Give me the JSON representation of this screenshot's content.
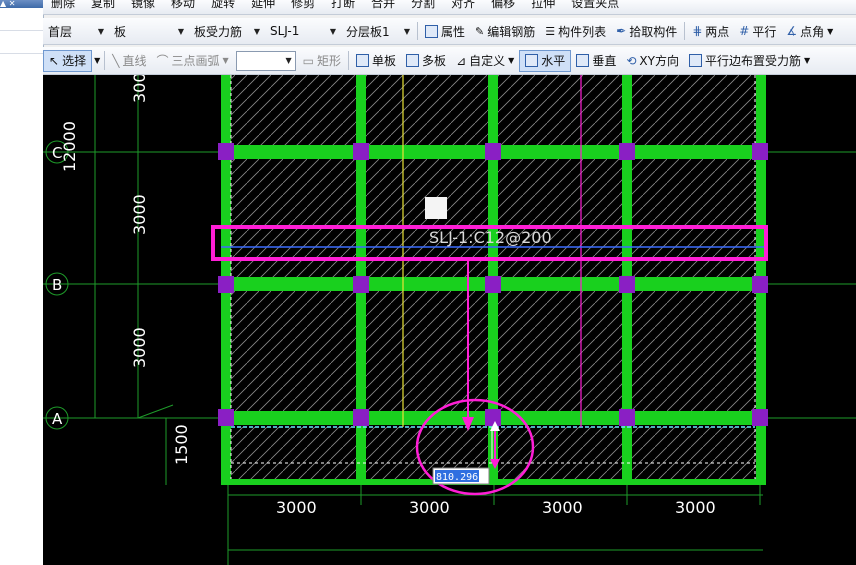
{
  "toolbar_top": {
    "items": [
      "删除",
      "复制",
      "镜像",
      "移动",
      "旋转",
      "延伸",
      "修剪",
      "打断",
      "合并",
      "分割",
      "对齐",
      "偏移",
      "拉伸",
      "设置夹点"
    ]
  },
  "toolbar_selectors": {
    "floor": "首层",
    "category": "板",
    "component_type": "板受力筋",
    "component_name": "SLJ-1",
    "layer": "分层板1",
    "buttons": [
      "属性",
      "编辑钢筋",
      "构件列表",
      "拾取构件",
      "两点",
      "平行",
      "点角"
    ]
  },
  "toolbar_draw": {
    "select": "选择",
    "line": "直线",
    "arc": "三点画弧",
    "rect": "矩形",
    "single_board": "单板",
    "multi_board": "多板",
    "custom": "自定义",
    "horizontal": "水平",
    "vertical": "垂直",
    "xy_direction": "XY方向",
    "parallel_edge": "平行边布置受力筋"
  },
  "drawing": {
    "axis_labels": [
      "C",
      "B",
      "A"
    ],
    "left_dims": [
      "3000",
      "12000",
      "3000",
      "3000",
      "1500"
    ],
    "bottom_dims": [
      "3000",
      "3000",
      "3000",
      "3000"
    ],
    "rebar_label": "SLJ-1:C12@200",
    "coord_input": "810.296"
  },
  "colors": {
    "beam": "#19d01e",
    "column": "#8a1fc4",
    "highlight": "#ff1ed6",
    "rebar_line": "#3a6cff",
    "axis": "#1e9b2a"
  }
}
